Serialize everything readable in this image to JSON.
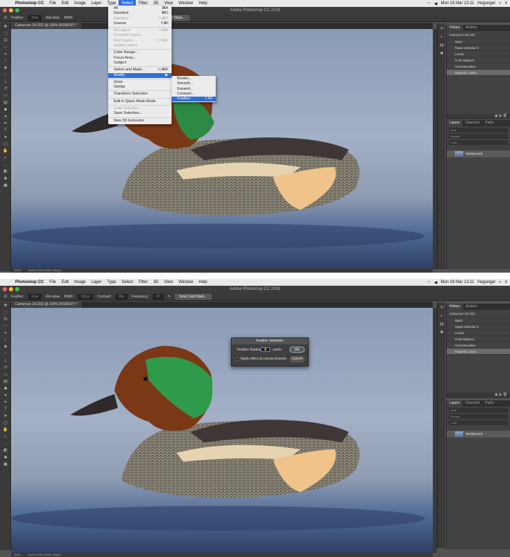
{
  "menubar": {
    "app": "Photoshop CC",
    "items": [
      "File",
      "Edit",
      "Image",
      "Layer",
      "Type",
      "Select",
      "Filter",
      "3D",
      "View",
      "Window",
      "Help"
    ],
    "active_index": 5,
    "clock": "Mon 19 Mar 13:11",
    "user": "Hogunger"
  },
  "window_title": "Adobe Photoshop CC 2018",
  "top": {
    "options": {
      "feather_label": "Feather:",
      "feather_value": "0 px",
      "anti_alias": "Anti-alias",
      "width_label": "Width",
      "select_mask": "Select and Mask..."
    },
    "doc_tab": "Camurcun 18.CR2 @ 100% (RGB/16*) *",
    "status": {
      "zoom": "100%",
      "profile": "Adobe RGB (1998) (16bpc)"
    }
  },
  "bottom": {
    "options": {
      "feather_label": "Feather:",
      "feather_value": "0 px",
      "anti_alias": "Anti-alias",
      "width_label": "Width:",
      "width_value": "10 px",
      "contrast_label": "Contrast:",
      "contrast_value": "6%",
      "frequency_label": "Frequency:",
      "frequency_value": "57",
      "select_mask": "Select and Mask..."
    },
    "doc_tab": "Camurcun 18.CR2 @ 100% (RGB/16*) *",
    "status": {
      "zoom": "100%",
      "profile": "Adobe RGB (1998) (16bpc)"
    }
  },
  "select_menu": [
    {
      "label": "All",
      "shortcut": "⌘A"
    },
    {
      "label": "Deselect",
      "shortcut": "⌘D"
    },
    {
      "label": "Reselect",
      "shortcut": "⇧⌘D",
      "disabled": true
    },
    {
      "label": "Inverse",
      "shortcut": "⇧⌘I"
    },
    {
      "sep": true
    },
    {
      "label": "All Layers",
      "shortcut": "⌥⌘A",
      "disabled": true
    },
    {
      "label": "Deselect Layers",
      "disabled": true
    },
    {
      "label": "Find Layers",
      "shortcut": "⌥⇧⌘F",
      "disabled": true
    },
    {
      "label": "Isolate Layers",
      "disabled": true
    },
    {
      "sep": true
    },
    {
      "label": "Color Range..."
    },
    {
      "label": "Focus Area..."
    },
    {
      "label": "Subject"
    },
    {
      "sep": true
    },
    {
      "label": "Select and Mask...",
      "shortcut": "⌥⌘R"
    },
    {
      "label": "Modify",
      "shortcut": "▶",
      "highlight": true
    },
    {
      "sep": true
    },
    {
      "label": "Grow"
    },
    {
      "label": "Similar"
    },
    {
      "sep": true
    },
    {
      "label": "Transform Selection"
    },
    {
      "sep": true
    },
    {
      "label": "Edit in Quick Mask Mode"
    },
    {
      "sep": true
    },
    {
      "label": "Load Selection...",
      "disabled": true
    },
    {
      "label": "Save Selection..."
    },
    {
      "sep": true
    },
    {
      "label": "New 3D Extrusion"
    }
  ],
  "modify_menu": [
    {
      "label": "Border..."
    },
    {
      "label": "Smooth..."
    },
    {
      "label": "Expand..."
    },
    {
      "label": "Contract..."
    },
    {
      "label": "Feather...",
      "shortcut": "⇧F6",
      "highlight": true
    }
  ],
  "history": {
    "tabs": [
      "History",
      "Actions"
    ],
    "snapshot": "Camurcun 18.CR2",
    "states": [
      "Open",
      "Topaz DeNoise 6",
      "Levels",
      "Color Balance",
      "Hue/Saturation",
      "Magnetic Lasso"
    ],
    "selected": "Magnetic Lasso"
  },
  "layers": {
    "tabs": [
      "Layers",
      "Channels",
      "Paths"
    ],
    "kind": "Kind",
    "blend": "Normal",
    "opacity": "Opacity:",
    "lock": "Lock:",
    "fill": "Fill:",
    "layer_name": "Background"
  },
  "dialog": {
    "title": "Feather Selection",
    "radius_label": "Feather Radius:",
    "radius_value": "8",
    "unit": "pixels",
    "checkbox": "Apply effect at canvas bounds",
    "ok": "OK",
    "cancel": "Cancel"
  }
}
